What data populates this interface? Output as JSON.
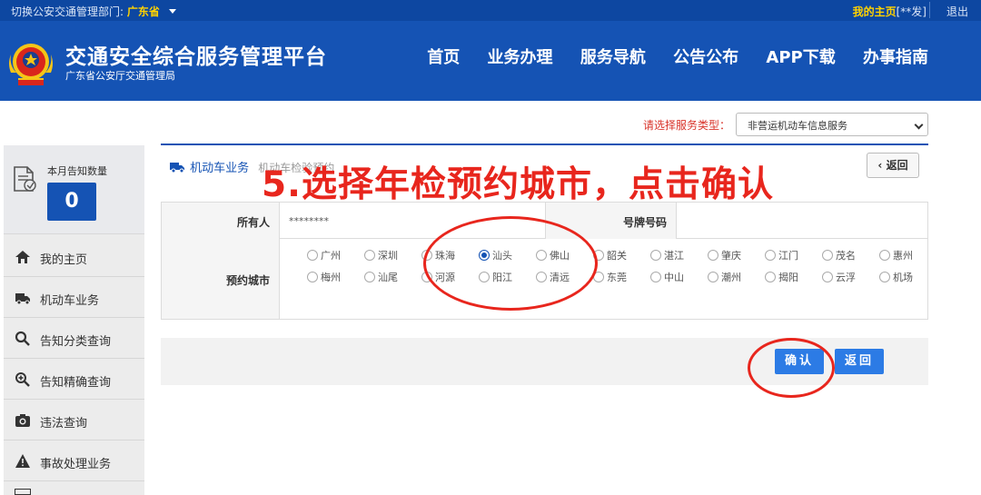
{
  "topbar": {
    "switch_label": "切换公安交通管理部门:",
    "province": "广东省",
    "my_home": "我的主页",
    "user_mask": "[**发]",
    "logout": "退出"
  },
  "header": {
    "title": "交通安全综合服务管理平台",
    "subtitle": "广东省公安厅交通管理局",
    "nav": [
      "首页",
      "业务办理",
      "服务导航",
      "公告公布",
      "APP下载",
      "办事指南"
    ]
  },
  "service_type": {
    "label": "请选择服务类型：",
    "selected": "非营运机动车信息服务"
  },
  "sidebar": {
    "notice_label": "本月告知数量",
    "notice_count": "0",
    "items": [
      {
        "label": "我的主页",
        "icon": "home-icon"
      },
      {
        "label": "机动车业务",
        "icon": "truck-icon"
      },
      {
        "label": "告知分类查询",
        "icon": "search-icon"
      },
      {
        "label": "告知精确查询",
        "icon": "zoom-icon"
      },
      {
        "label": "违法查询",
        "icon": "camera-icon"
      },
      {
        "label": "事故处理业务",
        "icon": "warning-icon"
      }
    ]
  },
  "panel": {
    "breadcrumb_main": "机动车业务",
    "breadcrumb_sub": "机动车检验预约",
    "back_label": "返回"
  },
  "instruction_overlay": "5.选择年检预约城市，点击确认",
  "form": {
    "owner_label": "所有人",
    "owner_value": "********",
    "plate_label": "号牌号码",
    "city_label": "预约城市",
    "cities_row1": [
      "广州",
      "深圳",
      "珠海",
      "汕头",
      "佛山",
      "韶关",
      "湛江",
      "肇庆",
      "江门",
      "茂名",
      "惠州"
    ],
    "cities_row2": [
      "梅州",
      "汕尾",
      "河源",
      "阳江",
      "清远",
      "东莞",
      "中山",
      "潮州",
      "揭阳",
      "云浮",
      "机场"
    ],
    "selected_city": "汕头"
  },
  "actions": {
    "confirm_label": "确认",
    "back_label": "返回"
  },
  "colors": {
    "brand_blue": "#1553b4",
    "accent_red": "#e8261d",
    "button_blue": "#2c7be5",
    "highlight_yellow": "#ffd200"
  }
}
